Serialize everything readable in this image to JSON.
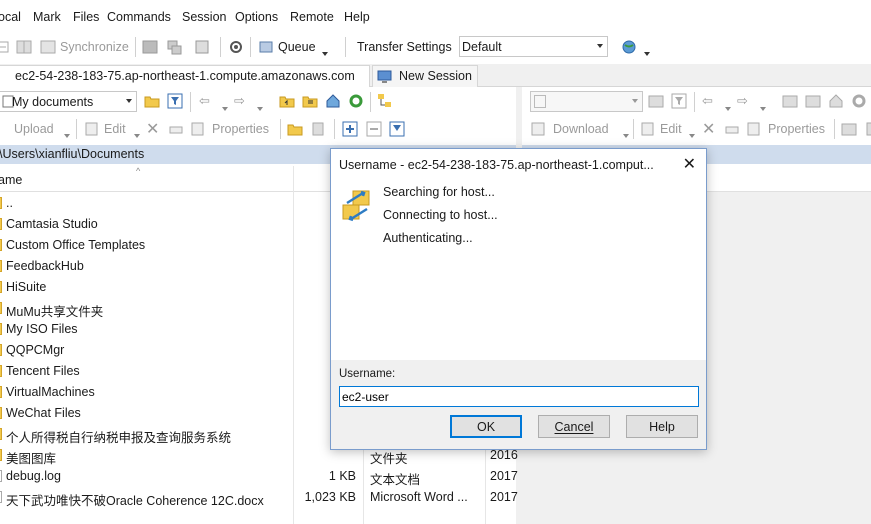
{
  "menu": [
    "ocal",
    "Mark",
    "Files",
    "Commands",
    "Session",
    "Options",
    "Remote",
    "Help"
  ],
  "toolbar": {
    "synchronize": "Synchronize",
    "queue": "Queue",
    "transfer_settings": "Transfer Settings",
    "transfer_default": "Default"
  },
  "tabs": {
    "session": "ec2-54-238-183-75.ap-northeast-1.compute.amazonaws.com",
    "new_session": "New Session"
  },
  "local": {
    "location": "My documents",
    "upload": "Upload",
    "edit": "Edit",
    "properties": "Properties",
    "path": "\\Users\\xianfliu\\Documents",
    "col_name": "ame",
    "files": [
      {
        "name": "..",
        "size": "",
        "type": "",
        "date": ""
      },
      {
        "name": "Camtasia Studio",
        "size": "",
        "type": "",
        "date": ""
      },
      {
        "name": "Custom Office Templates",
        "size": "",
        "type": "",
        "date": ""
      },
      {
        "name": "FeedbackHub",
        "size": "",
        "type": "",
        "date": ""
      },
      {
        "name": "HiSuite",
        "size": "",
        "type": "",
        "date": ""
      },
      {
        "name": "MuMu共享文件夹",
        "size": "",
        "type": "",
        "date": ""
      },
      {
        "name": "My ISO Files",
        "size": "",
        "type": "",
        "date": ""
      },
      {
        "name": "QQPCMgr",
        "size": "",
        "type": "",
        "date": ""
      },
      {
        "name": "Tencent Files",
        "size": "",
        "type": "",
        "date": ""
      },
      {
        "name": "VirtualMachines",
        "size": "",
        "type": "",
        "date": ""
      },
      {
        "name": "WeChat Files",
        "size": "",
        "type": "",
        "date": ""
      },
      {
        "name": "个人所得税自行纳税申报及查询服务系统",
        "size": "",
        "type": "",
        "date": ""
      },
      {
        "name": "美图图库",
        "size": "",
        "type": "文件夹",
        "date": "2016"
      },
      {
        "name": "debug.log",
        "size": "1 KB",
        "type": "文本文档",
        "date": "2017"
      },
      {
        "name": "天下武功唯快不破Oracle Coherence 12C.docx",
        "size": "1,023 KB",
        "type": "Microsoft Word ...",
        "date": "2017"
      }
    ]
  },
  "remote": {
    "download": "Download",
    "edit": "Edit",
    "properties": "Properties"
  },
  "dialog": {
    "title": "Username - ec2-54-238-183-75.ap-northeast-1.comput...",
    "status_lines": [
      "Searching for host...",
      "Connecting to host...",
      "Authenticating..."
    ],
    "username_label": "Username:",
    "username_value": "ec2-user",
    "ok": "OK",
    "cancel": "Cancel",
    "help": "Help"
  },
  "colors": {
    "path_bar": "#cfdced",
    "accent": "#0078d7",
    "folder": "#f2c94c"
  }
}
